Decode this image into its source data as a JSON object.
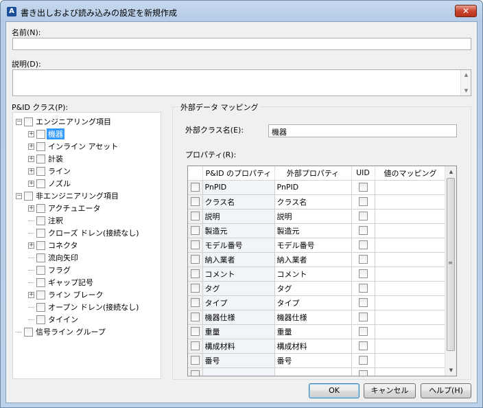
{
  "window": {
    "title": "書き出しおよび読み込みの設定を新規作成",
    "app_icon_glyph": "A",
    "close_glyph": "✕"
  },
  "name_field": {
    "label": "名前(N):",
    "value": ""
  },
  "description_field": {
    "label": "説明(D):",
    "value": ""
  },
  "tree": {
    "label": "P&ID クラス(P):",
    "items": [
      {
        "label": "エンジニアリング項目",
        "expander": "−"
      },
      {
        "label": "機器",
        "expander": "+",
        "selected": true
      },
      {
        "label": "インライン アセット",
        "expander": "+"
      },
      {
        "label": "計装",
        "expander": "+"
      },
      {
        "label": "ライン",
        "expander": "+"
      },
      {
        "label": "ノズル",
        "expander": "+"
      },
      {
        "label": "非エンジニアリング項目",
        "expander": "−"
      },
      {
        "label": "アクチュエータ",
        "expander": "+"
      },
      {
        "label": "注釈",
        "expander": ""
      },
      {
        "label": "クローズ ドレン(接続なし)",
        "expander": ""
      },
      {
        "label": "コネクタ",
        "expander": "+"
      },
      {
        "label": "流向矢印",
        "expander": ""
      },
      {
        "label": "フラグ",
        "expander": ""
      },
      {
        "label": "ギャップ記号",
        "expander": ""
      },
      {
        "label": "ライン ブレーク",
        "expander": "+"
      },
      {
        "label": "オープン ドレン(接続なし)",
        "expander": ""
      },
      {
        "label": "タイイン",
        "expander": ""
      },
      {
        "label": "信号ライン グループ",
        "expander": ""
      }
    ]
  },
  "mapping": {
    "group_title": "外部データ マッピング",
    "external_class_label": "外部クラス名(E):",
    "external_class_value": "機器",
    "properties_label": "プロパティ(R):",
    "columns": [
      "",
      "P&ID のプロパティ",
      "外部プロパティ",
      "UID",
      "値のマッピング"
    ],
    "rows": [
      {
        "pid": "PnPID",
        "ext": "PnPID"
      },
      {
        "pid": "クラス名",
        "ext": "クラス名"
      },
      {
        "pid": "説明",
        "ext": "説明"
      },
      {
        "pid": "製造元",
        "ext": "製造元"
      },
      {
        "pid": "モデル番号",
        "ext": "モデル番号"
      },
      {
        "pid": "納入業者",
        "ext": "納入業者"
      },
      {
        "pid": "コメント",
        "ext": "コメント"
      },
      {
        "pid": "タグ",
        "ext": "タグ"
      },
      {
        "pid": "タイプ",
        "ext": "タイプ"
      },
      {
        "pid": "機器仕様",
        "ext": "機器仕様"
      },
      {
        "pid": "重量",
        "ext": "重量"
      },
      {
        "pid": "構成材料",
        "ext": "構成材料"
      },
      {
        "pid": "番号",
        "ext": "番号"
      },
      {
        "pid": "",
        "ext": ""
      }
    ]
  },
  "buttons": {
    "ok": "OK",
    "cancel": "キャンセル",
    "help": "ヘルプ(H)"
  }
}
